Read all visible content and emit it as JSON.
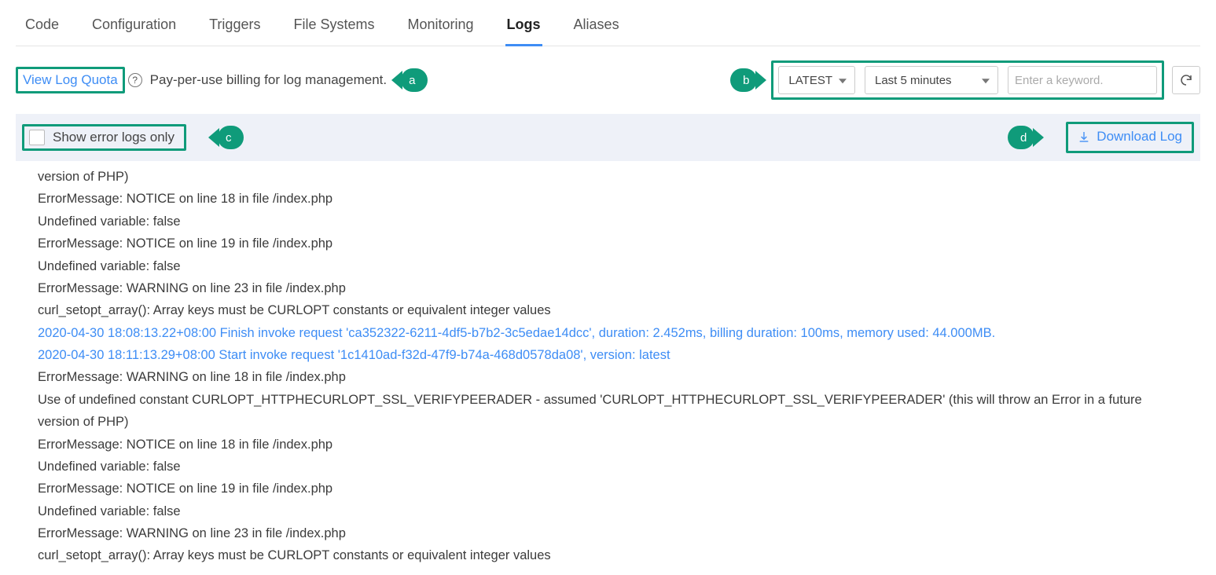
{
  "tabs": [
    "Code",
    "Configuration",
    "Triggers",
    "File Systems",
    "Monitoring",
    "Logs",
    "Aliases"
  ],
  "active_tab": "Logs",
  "toolbar": {
    "view_quota": "View Log Quota",
    "billing_text": "Pay-per-use billing for log management."
  },
  "markers": {
    "a": "a",
    "b": "b",
    "c": "c",
    "d": "d"
  },
  "filters": {
    "version": "LATEST",
    "range": "Last 5 minutes",
    "search_placeholder": "Enter a keyword."
  },
  "logs_header": {
    "show_errors": "Show error logs only",
    "download": "Download Log"
  },
  "log_lines": [
    {
      "t": "version of PHP)",
      "hl": false
    },
    {
      "t": "ErrorMessage: NOTICE on line 18 in file /index.php",
      "hl": false
    },
    {
      "t": "Undefined variable: false",
      "hl": false
    },
    {
      "t": "ErrorMessage: NOTICE on line 19 in file /index.php",
      "hl": false
    },
    {
      "t": "Undefined variable: false",
      "hl": false
    },
    {
      "t": "ErrorMessage: WARNING on line 23 in file /index.php",
      "hl": false
    },
    {
      "t": "curl_setopt_array(): Array keys must be CURLOPT constants or equivalent integer values",
      "hl": false
    },
    {
      "t": "2020-04-30 18:08:13.22+08:00 Finish invoke request 'ca352322-6211-4df5-b7b2-3c5edae14dcc', duration: 2.452ms, billing duration: 100ms, memory used: 44.000MB.",
      "hl": true
    },
    {
      "t": "2020-04-30 18:11:13.29+08:00 Start invoke request '1c1410ad-f32d-47f9-b74a-468d0578da08', version: latest",
      "hl": true
    },
    {
      "t": "ErrorMessage: WARNING on line 18 in file /index.php",
      "hl": false
    },
    {
      "t": "Use of undefined constant CURLOPT_HTTPHECURLOPT_SSL_VERIFYPEERADER - assumed 'CURLOPT_HTTPHECURLOPT_SSL_VERIFYPEERADER' (this will throw an Error in a future version of PHP)",
      "hl": false
    },
    {
      "t": "ErrorMessage: NOTICE on line 18 in file /index.php",
      "hl": false
    },
    {
      "t": "Undefined variable: false",
      "hl": false
    },
    {
      "t": "ErrorMessage: NOTICE on line 19 in file /index.php",
      "hl": false
    },
    {
      "t": "Undefined variable: false",
      "hl": false
    },
    {
      "t": "ErrorMessage: WARNING on line 23 in file /index.php",
      "hl": false
    },
    {
      "t": "curl_setopt_array(): Array keys must be CURLOPT constants or equivalent integer values",
      "hl": false
    }
  ]
}
